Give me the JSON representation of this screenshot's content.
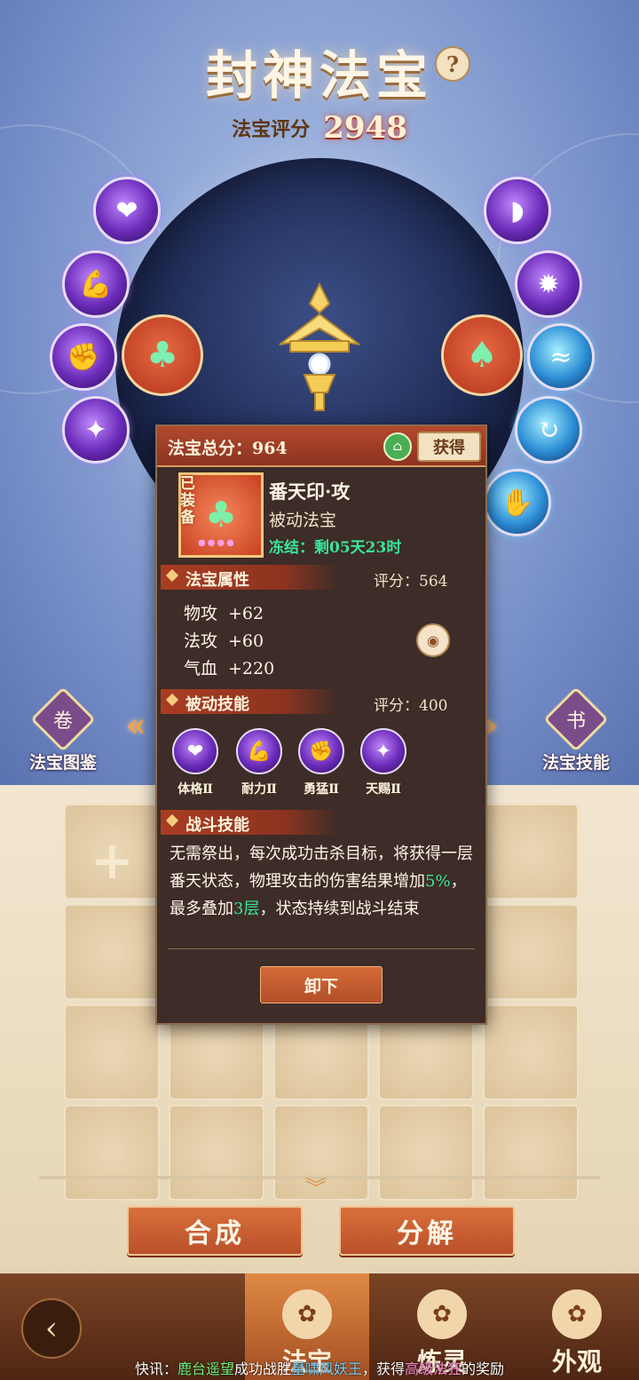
{
  "header": {
    "title": "封神法宝",
    "help_icon": "?",
    "score_label": "法宝评分",
    "score_value": "2948"
  },
  "left_skill_icons": [
    "heart-figure-icon",
    "muscle-arm-icon",
    "fist-icon",
    "radiant-figure-icon"
  ],
  "right_skill_icons": [
    "boot-icon",
    "burst-icon",
    "wave-icon",
    "vortex-icon",
    "glowing-hand-icon"
  ],
  "side_buttons": {
    "left_label": "法宝图鉴",
    "right_label": "法宝技能"
  },
  "actions": {
    "compose": "合成",
    "decompose": "分解"
  },
  "nav": {
    "tabs": [
      {
        "label": "法宝",
        "active": true
      },
      {
        "label": "炼灵",
        "active": false
      },
      {
        "label": "外观",
        "active": false
      }
    ]
  },
  "ticker": {
    "prefix": "快讯：",
    "player": "鹿台遥望",
    "text1": "成功战胜",
    "boss": "星啸风妖王",
    "text2": "，获得",
    "reward": "高级法狂",
    "text3": "的奖励"
  },
  "popup": {
    "total_label": "法宝总分：964",
    "get_label": "获得",
    "equipped_tag": "已装备",
    "item_name": "番天印·攻",
    "item_type": "被动法宝",
    "freeze": "冻结：剩05天23时",
    "attr_section": {
      "title": "法宝属性",
      "score": "评分：564"
    },
    "attributes": [
      {
        "name": "物攻",
        "value": "+62"
      },
      {
        "name": "法攻",
        "value": "+60"
      },
      {
        "name": "气血",
        "value": "+220"
      }
    ],
    "passive_section": {
      "title": "被动技能",
      "score": "评分：400"
    },
    "passive_skills": [
      {
        "name": "体格Ⅱ",
        "icon": "heart-figure-icon"
      },
      {
        "name": "耐力Ⅱ",
        "icon": "muscle-arm-icon"
      },
      {
        "name": "勇猛Ⅱ",
        "icon": "fist-icon"
      },
      {
        "name": "天赐Ⅱ",
        "icon": "radiant-figure-icon"
      }
    ],
    "battle_section": {
      "title": "战斗技能"
    },
    "battle_desc_1": "无需祭出，每次成功击杀目标，将获得一层番天状态，物理攻击的伤害结果增加",
    "battle_pct": "5%",
    "battle_desc_2": "，最多叠加",
    "battle_layers": "3层",
    "battle_desc_3": "，状态持续到战斗结束",
    "unequip_label": "卸下"
  },
  "colors": {
    "accent_orange": "#c9592d",
    "freeze_green": "#38e69a",
    "score_red": "#d3493a"
  }
}
